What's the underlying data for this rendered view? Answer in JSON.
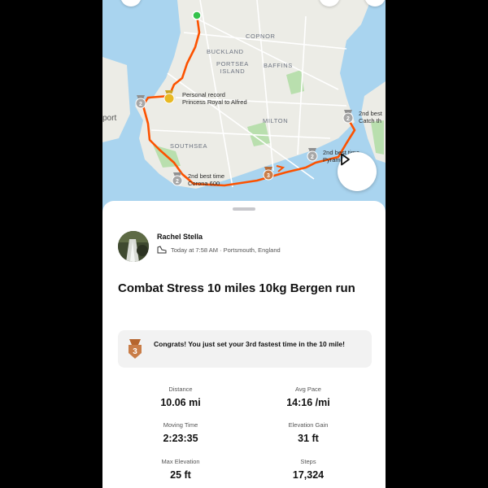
{
  "map": {
    "labels": {
      "copnor": "COPNOR",
      "buckland": "BUCKLAND",
      "portsea_island": "PORTSEA\nISLAND",
      "baffins": "BAFFINS",
      "milton": "MILTON",
      "southsea": "SOUTHSEA",
      "port": "port",
      "partial_top": "yp"
    },
    "segments": {
      "personal_record": "Personal record\nPrincess Royal to Alfred",
      "second_best_catch": "2nd best\nCatch th",
      "second_best_pyramids": "2nd best time\nPyram     avan",
      "second_best_corona": "2nd best time\nCorona 600"
    },
    "route_color": "#fc5200",
    "play_icon": "play-icon"
  },
  "activity": {
    "athlete_name": "Rachel Stella",
    "meta": "Today at 7:58 AM · Portsmouth, England",
    "title": "Combat Stress 10 miles 10kg Bergen run",
    "congrats": "Congrats! You just set your 3rd fastest time in the 10 mile!",
    "medal_rank": "3"
  },
  "stats": {
    "distance": {
      "label": "Distance",
      "value": "10.06 mi"
    },
    "avg_pace": {
      "label": "Avg Pace",
      "value": "14:16 /mi"
    },
    "moving_time": {
      "label": "Moving Time",
      "value": "2:23:35"
    },
    "elevation_gain": {
      "label": "Elevation Gain",
      "value": "31 ft"
    },
    "max_elevation": {
      "label": "Max Elevation",
      "value": "25 ft"
    },
    "steps": {
      "label": "Steps",
      "value": "17,324"
    }
  }
}
